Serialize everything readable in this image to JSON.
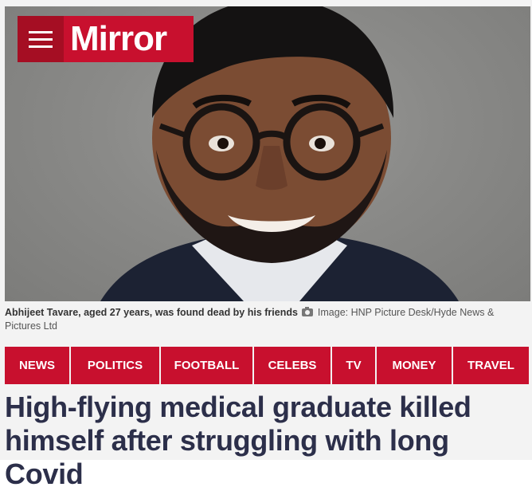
{
  "header": {
    "logo_text": "Mirror",
    "menu_icon": "hamburger-menu-icon"
  },
  "hero": {
    "alt": "Abhijeet Tavare"
  },
  "caption": {
    "text": "Abhijeet Tavare, aged 27 years, was found dead by his friends",
    "credit": "Image: HNP Picture Desk/Hyde News & Pictures Ltd",
    "icon": "camera-icon"
  },
  "nav": {
    "items": [
      "NEWS",
      "POLITICS",
      "FOOTBALL",
      "CELEBS",
      "TV",
      "MONEY",
      "TRAVEL"
    ]
  },
  "article": {
    "headline": "High-flying medical graduate killed himself after struggling with long Covid"
  },
  "colors": {
    "brand": "#c8102e",
    "headline": "#2c2f4a"
  }
}
